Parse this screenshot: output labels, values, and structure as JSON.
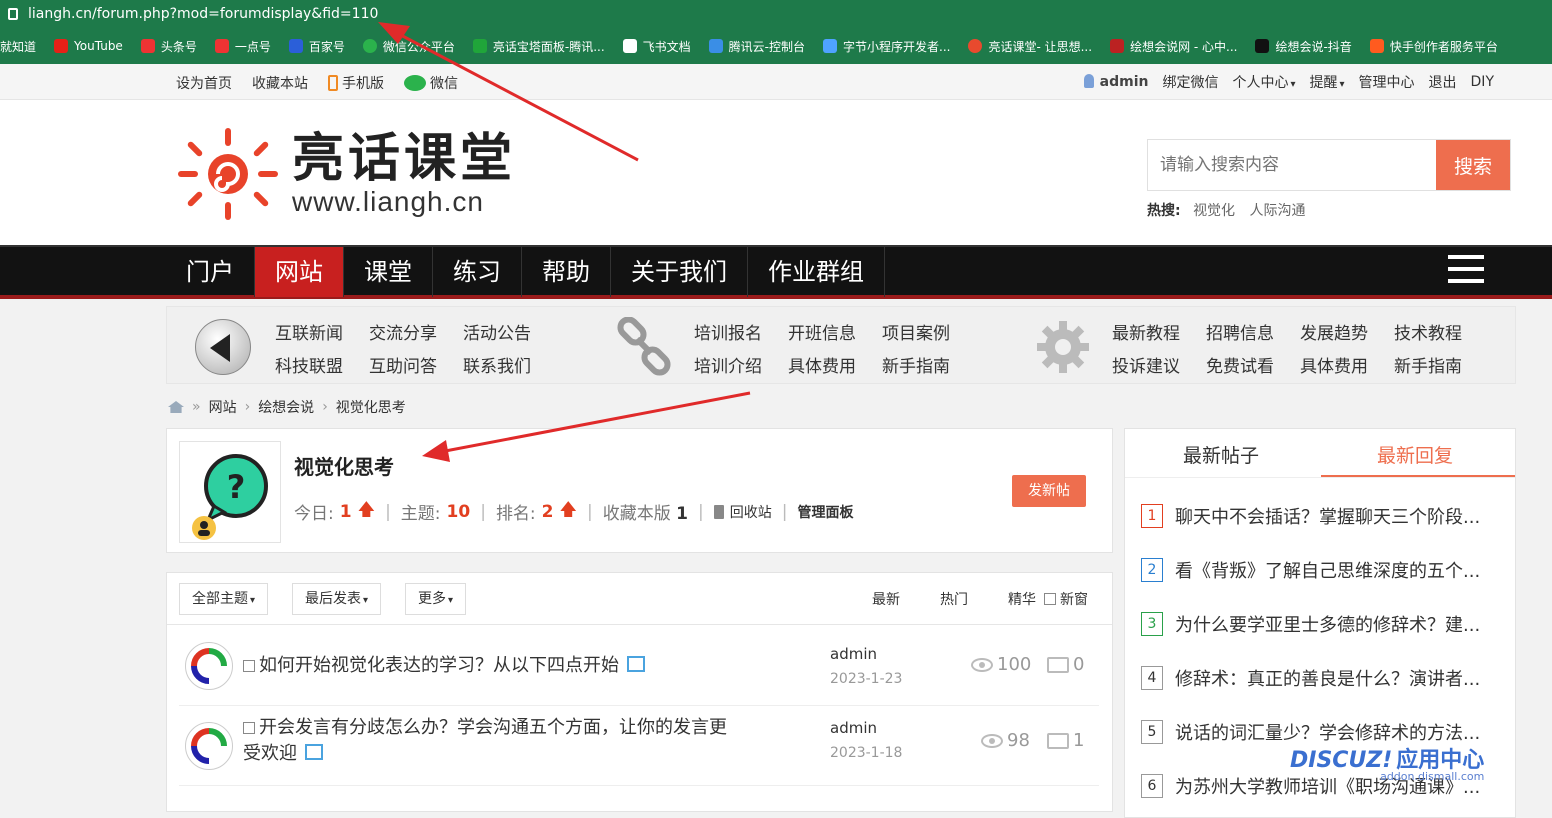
{
  "browser": {
    "url": "liangh.cn/forum.php?mod=forumdisplay&fid=110",
    "bookmarks": [
      "就知道",
      "YouTube",
      "头条号",
      "一点号",
      "百家号",
      "微信公众平台",
      "亮话宝塔面板-腾讯...",
      "飞书文档",
      "腾讯云-控制台",
      "字节小程序开发者...",
      "亮话课堂- 让思想...",
      "绘想会说网 - 心中...",
      "绘想会说-抖音",
      "快手创作者服务平台"
    ]
  },
  "topbar": {
    "left": [
      "设为首页",
      "收藏本站",
      "手机版",
      "微信"
    ],
    "user": "admin",
    "right": [
      "绑定微信",
      "个人中心",
      "提醒",
      "管理中心",
      "退出",
      "DIY"
    ]
  },
  "header": {
    "logo_cn": "亮话课堂",
    "logo_url": "www.liangh.cn",
    "search_placeholder": "请输入搜索内容",
    "search_button": "搜索",
    "hot_label": "热搜:",
    "hot_terms": [
      "视觉化",
      "人际沟通"
    ]
  },
  "nav": {
    "items": [
      "门户",
      "网站",
      "课堂",
      "练习",
      "帮助",
      "关于我们",
      "作业群组"
    ],
    "active": "网站"
  },
  "subnav": {
    "group1": [
      "互联新闻",
      "交流分享",
      "活动公告",
      "科技联盟",
      "互助问答",
      "联系我们"
    ],
    "group2": [
      "培训报名",
      "开班信息",
      "项目案例",
      "培训介绍",
      "具体费用",
      "新手指南"
    ],
    "group3": [
      "最新教程",
      "招聘信息",
      "发展趋势",
      "技术教程",
      "投诉建议",
      "免费试看",
      "具体费用",
      "新手指南"
    ]
  },
  "breadcrumb": [
    "网站",
    "绘想会说",
    "视觉化思考"
  ],
  "forum": {
    "name": "视觉化思考",
    "today_label": "今日:",
    "today": "1",
    "topics_label": "主题:",
    "topics": "10",
    "rank_label": "排名:",
    "rank": "2",
    "fav_label": "收藏本版",
    "fav": "1",
    "recycle": "回收站",
    "manage": "管理面板",
    "new_post": "发新帖"
  },
  "threadbar": {
    "filters": [
      "全部主题",
      "最后发表",
      "更多"
    ],
    "tabs": [
      "最新",
      "热门",
      "精华"
    ],
    "newwin": "新窗"
  },
  "threads": [
    {
      "title": "如何开始视觉化表达的学习？从以下四点开始",
      "author": "admin",
      "date": "2023-1-23",
      "views": "100",
      "replies": "0"
    },
    {
      "title": "开会发言有分歧怎么办？学会沟通五个方面，让你的发言更受欢迎",
      "author": "admin",
      "date": "2023-1-18",
      "views": "98",
      "replies": "1"
    }
  ],
  "sidebar": {
    "tabs": [
      "最新帖子",
      "最新回复"
    ],
    "items": [
      {
        "rank": "1",
        "color": "#e23f20",
        "title": "聊天中不会插话？掌握聊天三个阶段..."
      },
      {
        "rank": "2",
        "color": "#2a7fd0",
        "title": "看《背叛》了解自己思维深度的五个..."
      },
      {
        "rank": "3",
        "color": "#2aa14a",
        "title": "为什么要学亚里士多德的修辞术？建..."
      },
      {
        "rank": "4",
        "color": "#888888",
        "title": "修辞术：真正的善良是什么？演讲者..."
      },
      {
        "rank": "5",
        "color": "#888888",
        "title": "说话的词汇量少？学会修辞术的方法..."
      },
      {
        "rank": "6",
        "color": "#888888",
        "title": "为苏州大学教师培训《职场沟通课》..."
      }
    ]
  },
  "watermark": {
    "brand": "DISCUZ!",
    "sub": "应用中心",
    "domain": "addon.dismall.com"
  },
  "colors": {
    "accent": "#ee6e4e",
    "nav_active": "#c8201f",
    "nav_bg": "#121212",
    "browser": "#1e7a4a"
  }
}
